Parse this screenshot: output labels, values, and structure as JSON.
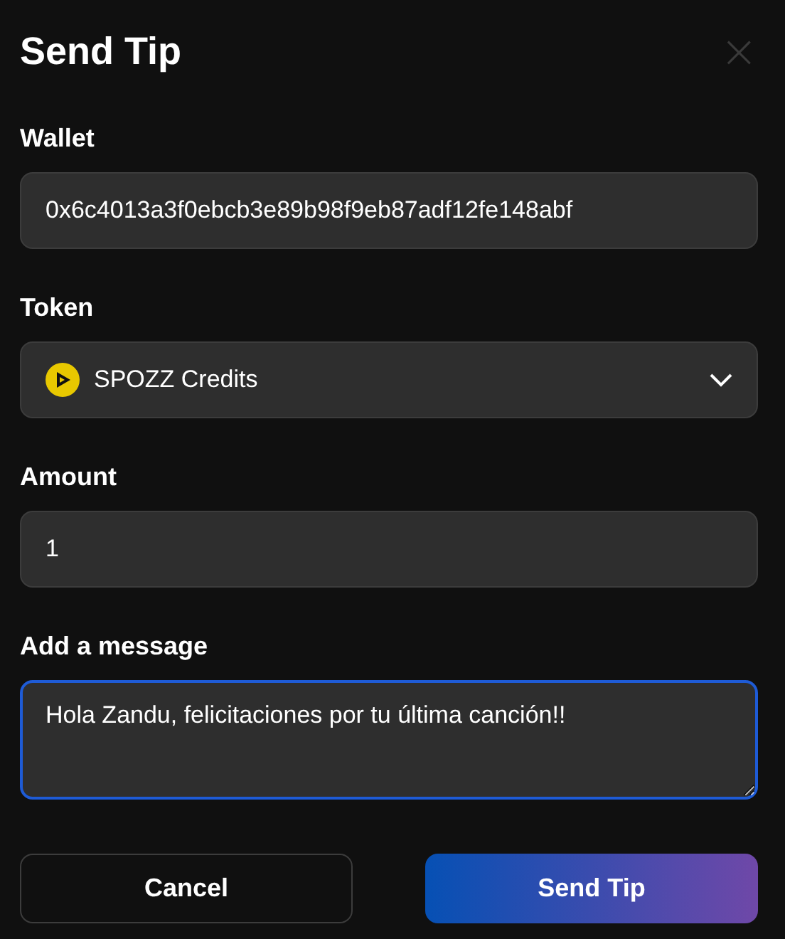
{
  "dialog": {
    "title": "Send Tip",
    "close": "×"
  },
  "wallet": {
    "label": "Wallet",
    "value": "0x6c4013a3f0ebcb3e89b98f9eb87adf12fe148abf"
  },
  "token": {
    "label": "Token",
    "value": "SPOZZ Credits"
  },
  "amount": {
    "label": "Amount",
    "value": "1"
  },
  "message": {
    "label": "Add a message",
    "value": "Hola Zandu, felicitaciones por tu última canción!!",
    "focused": true
  },
  "buttons": [
    {
      "label": "Cancel",
      "kind": "secondary"
    },
    {
      "label": "Send Tip",
      "kind": "primary"
    }
  ]
}
